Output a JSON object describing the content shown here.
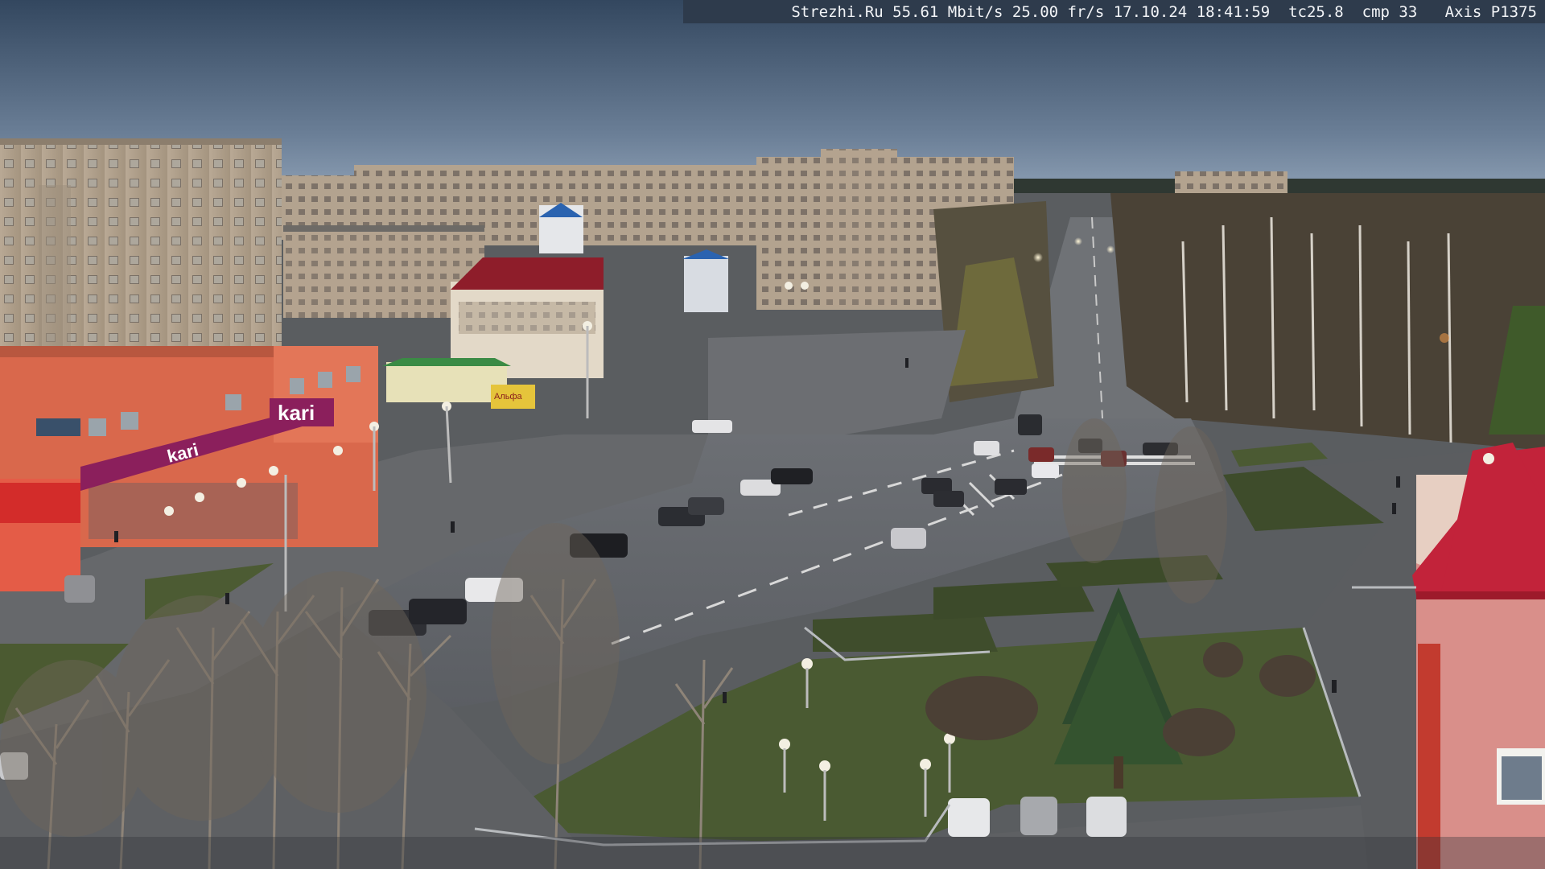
{
  "overlay": {
    "site": "Strezhi.Ru",
    "bitrate": "55.61 Mbit/s",
    "framerate": "25.00 fr/s",
    "date": "17.10.24",
    "time": "18:41:59",
    "tc": "tc25.8",
    "cmp": "cmp 33",
    "camera": "Axis P1375"
  },
  "signs": {
    "store_name": "kari",
    "store_sign_secondary": "kari",
    "bank_sign": "Альфа"
  },
  "colors": {
    "sky_top": "#33475f",
    "sky_horizon": "#8d9fb4",
    "road": "#65686d",
    "grass": "#4a5a32",
    "store_facade": "#d9684c",
    "kari_banner": "#8b1f5c",
    "red_roof": "#c2233a"
  }
}
